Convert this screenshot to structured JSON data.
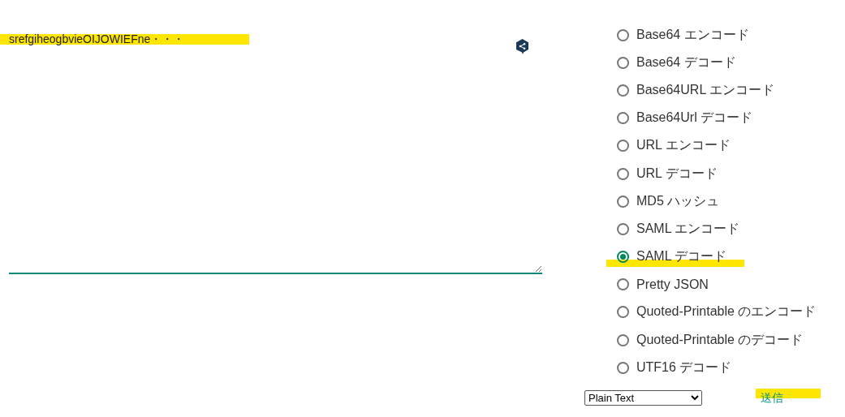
{
  "input": {
    "value": "srefgiheogbvieOIJOWIEFne・・・",
    "highlighted": true
  },
  "options": [
    {
      "label": "Base64 エンコード",
      "selected": false,
      "highlighted": false
    },
    {
      "label": "Base64 デコード",
      "selected": false,
      "highlighted": false
    },
    {
      "label": "Base64URL エンコード",
      "selected": false,
      "highlighted": false
    },
    {
      "label": "Base64Url デコード",
      "selected": false,
      "highlighted": false
    },
    {
      "label": "URL エンコード",
      "selected": false,
      "highlighted": false
    },
    {
      "label": "URL デコード",
      "selected": false,
      "highlighted": false
    },
    {
      "label": "MD5 ハッシュ",
      "selected": false,
      "highlighted": false
    },
    {
      "label": "SAML エンコード",
      "selected": false,
      "highlighted": false
    },
    {
      "label": "SAML デコード",
      "selected": true,
      "highlighted": true
    },
    {
      "label": "Pretty JSON",
      "selected": false,
      "highlighted": false
    },
    {
      "label": "Quoted-Printable のエンコード",
      "selected": false,
      "highlighted": false
    },
    {
      "label": "Quoted-Printable のデコード",
      "selected": false,
      "highlighted": false
    },
    {
      "label": "UTF16 デコード",
      "selected": false,
      "highlighted": false
    }
  ],
  "format": {
    "value": "Plain Text"
  },
  "submit": {
    "label": "送信",
    "highlighted": true
  }
}
